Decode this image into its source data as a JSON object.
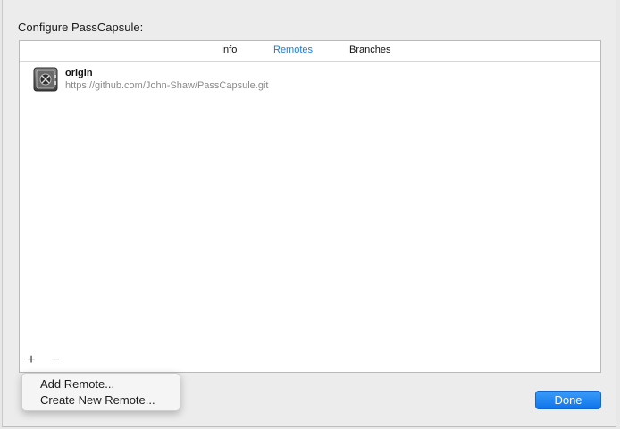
{
  "dialog": {
    "title": "Configure PassCapsule:"
  },
  "tabs": [
    {
      "label": "Info",
      "active": false
    },
    {
      "label": "Remotes",
      "active": true
    },
    {
      "label": "Branches",
      "active": false
    }
  ],
  "remotes": [
    {
      "name": "origin",
      "url": "https://github.com/John-Shaw/PassCapsule.git",
      "icon": "safe-icon"
    }
  ],
  "controls": {
    "add": "+",
    "remove": "−"
  },
  "add_menu": {
    "items": [
      "Add Remote...",
      "Create New Remote..."
    ]
  },
  "buttons": {
    "done": "Done"
  },
  "colors": {
    "accent": "#1a7ce0",
    "done_button": "#1a84f0"
  }
}
